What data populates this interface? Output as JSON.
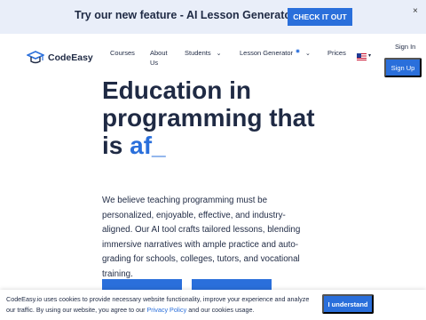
{
  "promo": {
    "text": "Try our new feature - AI Lesson Generator!",
    "button": "CHECK IT OUT",
    "close": "×"
  },
  "header": {
    "logo_text": "CodeEasy",
    "nav": [
      {
        "label": "Courses"
      },
      {
        "label": "About\nUs"
      },
      {
        "label": "Students"
      },
      {
        "label": "Lesson Generator"
      },
      {
        "label": "Prices"
      }
    ],
    "signin": "Sign In",
    "signup": "Sign Up",
    "language_icon": "us-flag-icon"
  },
  "hero": {
    "title_line1": "Education in",
    "title_line2": "programming that",
    "title_line3_prefix": "is ",
    "title_line3_accent": "af_",
    "description": "We believe teaching programming must be personalized, enjoyable, effective, and industry-aligned. Our AI tool crafts tailored lessons, blending immersive narratives with ample practice and auto-grading for schools, colleges, tutors, and vocational training."
  },
  "cookie": {
    "text_before": "CodeEasy.io uses cookies to provide necessary website functionality, improve your experience and analyze our traffic. By using our website, you agree to our ",
    "link": "Privacy Policy",
    "text_after": " and our cookies usage.",
    "button": "I understand"
  },
  "colors": {
    "accent": "#2a6fdb",
    "text": "#1f2a44",
    "banner_bg": "#e9eef9"
  }
}
